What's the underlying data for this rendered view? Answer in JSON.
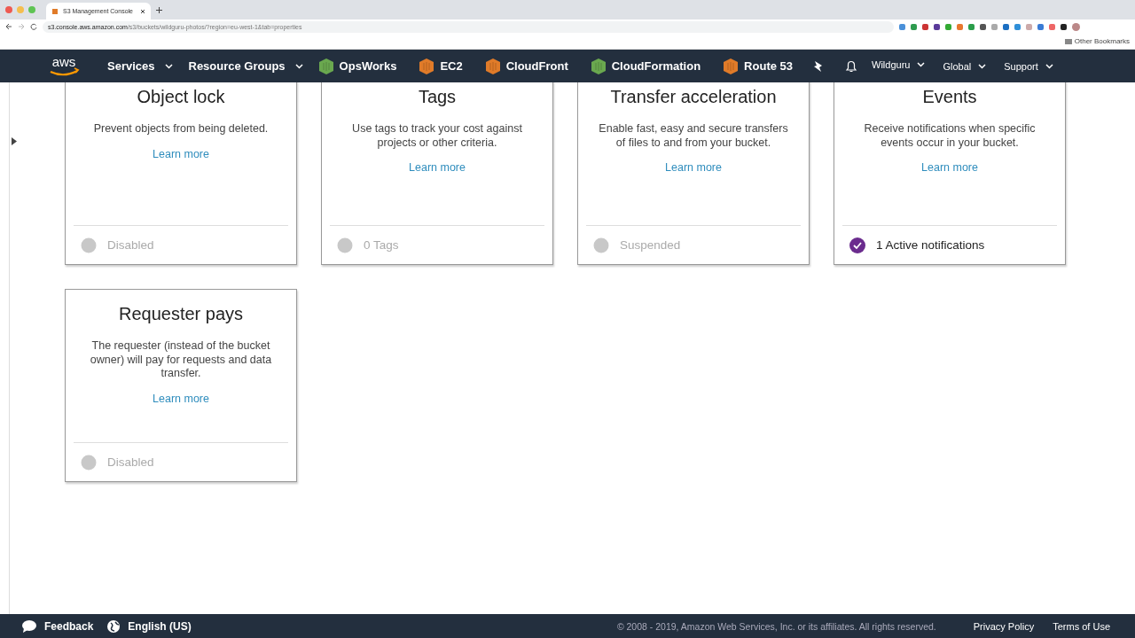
{
  "browser": {
    "tab_title": "S3 Management Console",
    "url_host": "s3.console.aws.amazon.com",
    "url_path": "/s3/buckets/wildguru-photos/?region=eu-west-1&tab=properties",
    "bookmarks": [
      "Other Bookmarks"
    ]
  },
  "nav": {
    "logo": "aws",
    "menus": [
      {
        "label": "Services"
      },
      {
        "label": "Resource Groups"
      }
    ],
    "shortcuts": [
      {
        "label": "OpsWorks",
        "color": "#6aa84f"
      },
      {
        "label": "EC2",
        "color": "#e07b29"
      },
      {
        "label": "CloudFront",
        "color": "#e07b29"
      },
      {
        "label": "CloudFormation",
        "color": "#6aa84f"
      },
      {
        "label": "Route 53",
        "color": "#e07b29"
      }
    ],
    "account": "Wildguru",
    "region": "Global",
    "support": "Support"
  },
  "cards": [
    {
      "title": "Object lock",
      "description": "Prevent objects from being deleted.",
      "link": "Learn more",
      "status": "Disabled",
      "on": false
    },
    {
      "title": "Tags",
      "description": "Use tags to track your cost against projects or other criteria.",
      "link": "Learn more",
      "status": "0 Tags",
      "on": false
    },
    {
      "title": "Transfer acceleration",
      "description": "Enable fast, easy and secure transfers of files to and from your bucket.",
      "link": "Learn more",
      "status": "Suspended",
      "on": false
    },
    {
      "title": "Events",
      "description": "Receive notifications when specific events occur in your bucket.",
      "link": "Learn more",
      "status": "1 Active notifications",
      "on": true
    },
    {
      "title": "Requester pays",
      "description": "The requester (instead of the bucket owner) will pay for requests and data transfer.",
      "link": "Learn more",
      "status": "Disabled",
      "on": false
    }
  ],
  "footer": {
    "feedback": "Feedback",
    "language": "English (US)",
    "copyright": "© 2008 - 2019, Amazon Web Services, Inc. or its affiliates. All rights reserved.",
    "links": [
      "Privacy Policy",
      "Terms of Use"
    ]
  }
}
